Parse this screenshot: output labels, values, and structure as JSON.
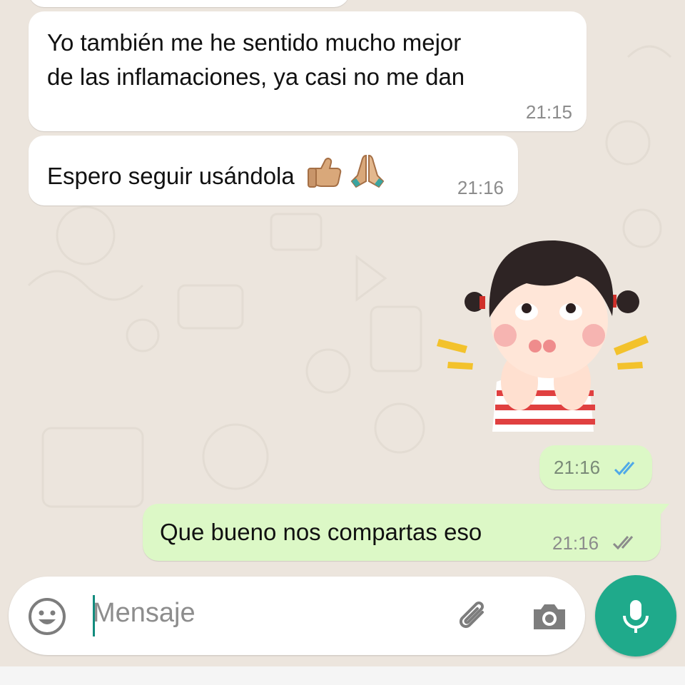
{
  "messages": [
    {
      "id": "prev",
      "direction": "incoming",
      "text": "",
      "time": ""
    },
    {
      "id": "m1",
      "direction": "incoming",
      "lines": [
        "Yo también me he sentido mucho mejor",
        "de las inflamaciones, ya casi no me dan"
      ],
      "time": "21:15"
    },
    {
      "id": "m2",
      "direction": "incoming",
      "text": "Espero seguir usándola",
      "emojis": [
        "thumbs-up-icon",
        "folded-hands-icon"
      ],
      "time": "21:16"
    },
    {
      "id": "m3",
      "direction": "outgoing",
      "type": "sticker",
      "sticker": "girl-puffed-cheeks-sticker",
      "time": "21:16",
      "status": "read"
    },
    {
      "id": "m4",
      "direction": "outgoing",
      "text": "Que bueno nos compartas eso",
      "time": "21:16",
      "status": "delivered"
    }
  ],
  "composer": {
    "placeholder": "Mensaje",
    "icons": [
      "emoji-icon",
      "attach-icon",
      "camera-icon",
      "mic-icon"
    ]
  },
  "colors": {
    "background": "#ece5dd",
    "incoming_bubble": "#ffffff",
    "outgoing_bubble": "#dcf8c6",
    "read_ticks": "#4fa9e8",
    "delivered_ticks": "#8c8c8c",
    "accent": "#1faa8b"
  }
}
